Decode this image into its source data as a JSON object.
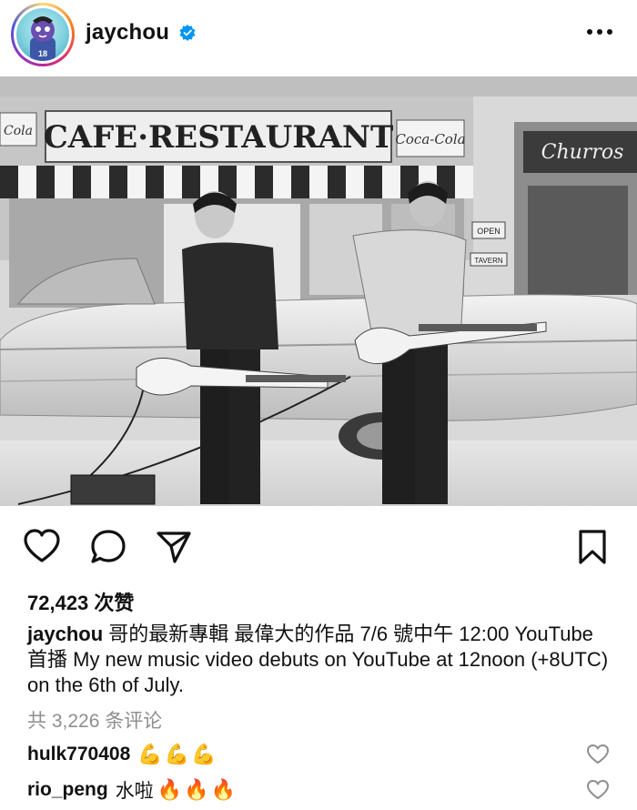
{
  "post": {
    "username": "jaychou",
    "verified": true,
    "more_icon": "more-horizontal-icon",
    "avatar_badge_number": "18",
    "photo_sign_main": "CAFE·RESTAURANT",
    "photo_sign_cola": "Coca-Cola",
    "photo_sign_churros": "Churros",
    "photo_sign_open": "OPEN",
    "photo_sign_tavern": "TAVERN"
  },
  "actions": {
    "like_icon": "heart-icon",
    "comment_icon": "comment-icon",
    "share_icon": "send-icon",
    "save_icon": "bookmark-icon"
  },
  "likes": {
    "text": "72,423 次赞"
  },
  "caption": {
    "user": "jaychou",
    "text": "哥的最新專輯 最偉大的作品 7/6 號中午 12:00 YouTube 首播 My new music video debuts on YouTube at 12noon (+8UTC) on the 6th of July."
  },
  "comments_link": "共 3,226 条评论",
  "comments": [
    {
      "user": "hulk770408",
      "text": "",
      "emoji": "💪💪💪"
    },
    {
      "user": "rio_peng",
      "text": "水啦",
      "emoji": "🔥🔥🔥"
    }
  ],
  "colors": {
    "verified_blue": "#0095f6",
    "muted": "#8e8e8e"
  }
}
